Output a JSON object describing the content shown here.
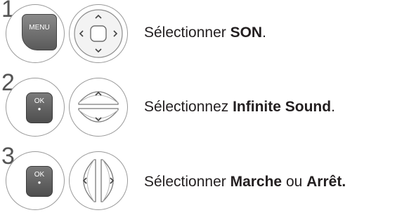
{
  "steps": [
    {
      "number": "1",
      "key_label": "MENU",
      "pad": "4-way navigation pad",
      "text_before": "Sélectionner ",
      "text_bold": "SON",
      "text_after": "."
    },
    {
      "number": "2",
      "key_label": "OK",
      "pad": "up-down navigation pad",
      "text_before": "Sélectionnez ",
      "text_bold": "Infinite Sound",
      "text_after": "."
    },
    {
      "number": "3",
      "key_label": "OK",
      "pad": "left-right navigation pad",
      "text_before": "Sélectionner ",
      "text_bold": "Marche",
      "text_middle": " ou ",
      "text_bold2": "Arrêt."
    }
  ],
  "icons": {
    "ok_dot": "●"
  }
}
